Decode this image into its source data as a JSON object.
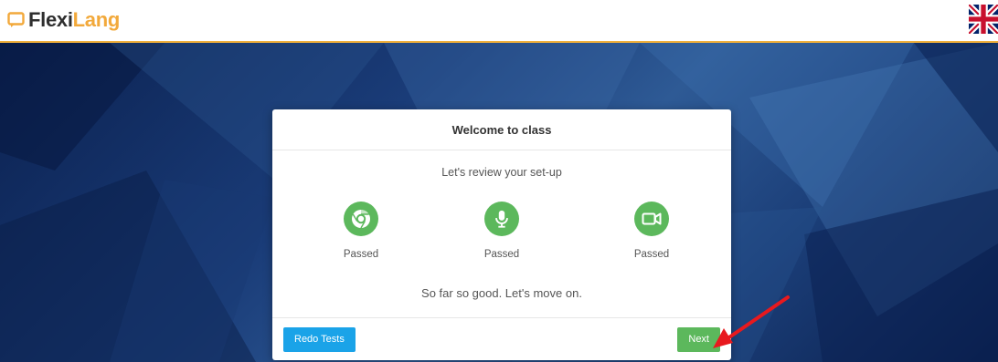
{
  "header": {
    "logo_part1": "Flexi",
    "logo_part2": "Lang",
    "language_flag": "uk-flag-icon",
    "accent_color": "#f0b03c"
  },
  "modal": {
    "title": "Welcome to class",
    "subtitle": "Let's review your set-up",
    "checks": [
      {
        "icon": "chrome-icon",
        "status": "Passed"
      },
      {
        "icon": "microphone-icon",
        "status": "Passed"
      },
      {
        "icon": "camera-icon",
        "status": "Passed"
      }
    ],
    "message": "So far so good. Let's move on.",
    "redo_label": "Redo Tests",
    "next_label": "Next",
    "success_color": "#5cb85c",
    "info_color": "#1aa3e8"
  },
  "annotation": {
    "icon": "red-arrow-icon",
    "color": "#e8191e"
  }
}
